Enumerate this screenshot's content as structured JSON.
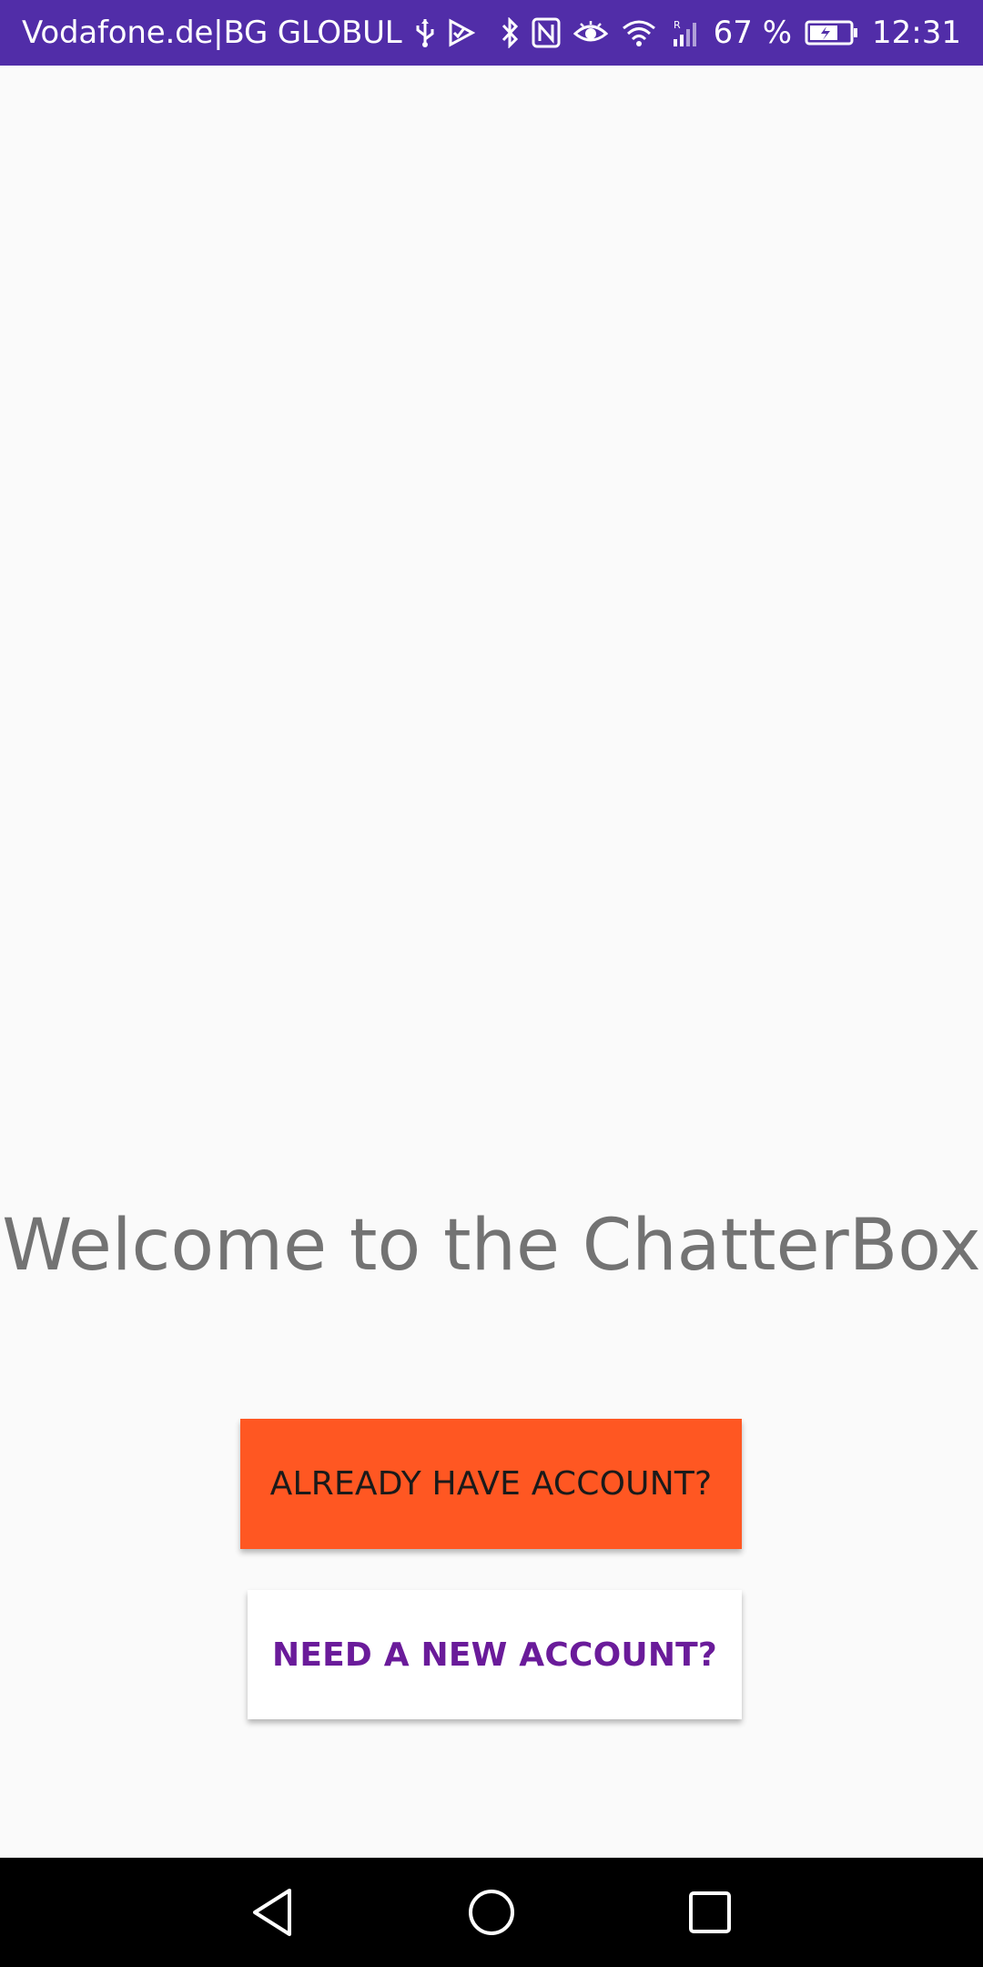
{
  "status_bar": {
    "carrier": "Vodafone.de|BG GLOBUL",
    "battery_percent": "67 %",
    "time": "12:31",
    "background_color": "#512da8",
    "icons_left": [
      "usb-icon",
      "check-flag-icon"
    ],
    "icons_right": [
      "bluetooth-icon",
      "nfc-icon",
      "eye-icon",
      "wifi-icon",
      "signal-icon",
      "battery-icon"
    ]
  },
  "main": {
    "welcome_title": "Welcome to the ChatterBox",
    "already_button_label": "ALREADY HAVE ACCOUNT?",
    "new_account_button_label": "NEED A NEW ACCOUNT?",
    "colors": {
      "already_button_bg": "#ff5722",
      "new_account_text": "#6a1b9a",
      "title_text": "#737373"
    }
  },
  "nav_bar": {
    "buttons": [
      "back-icon",
      "home-icon",
      "recents-icon"
    ]
  }
}
